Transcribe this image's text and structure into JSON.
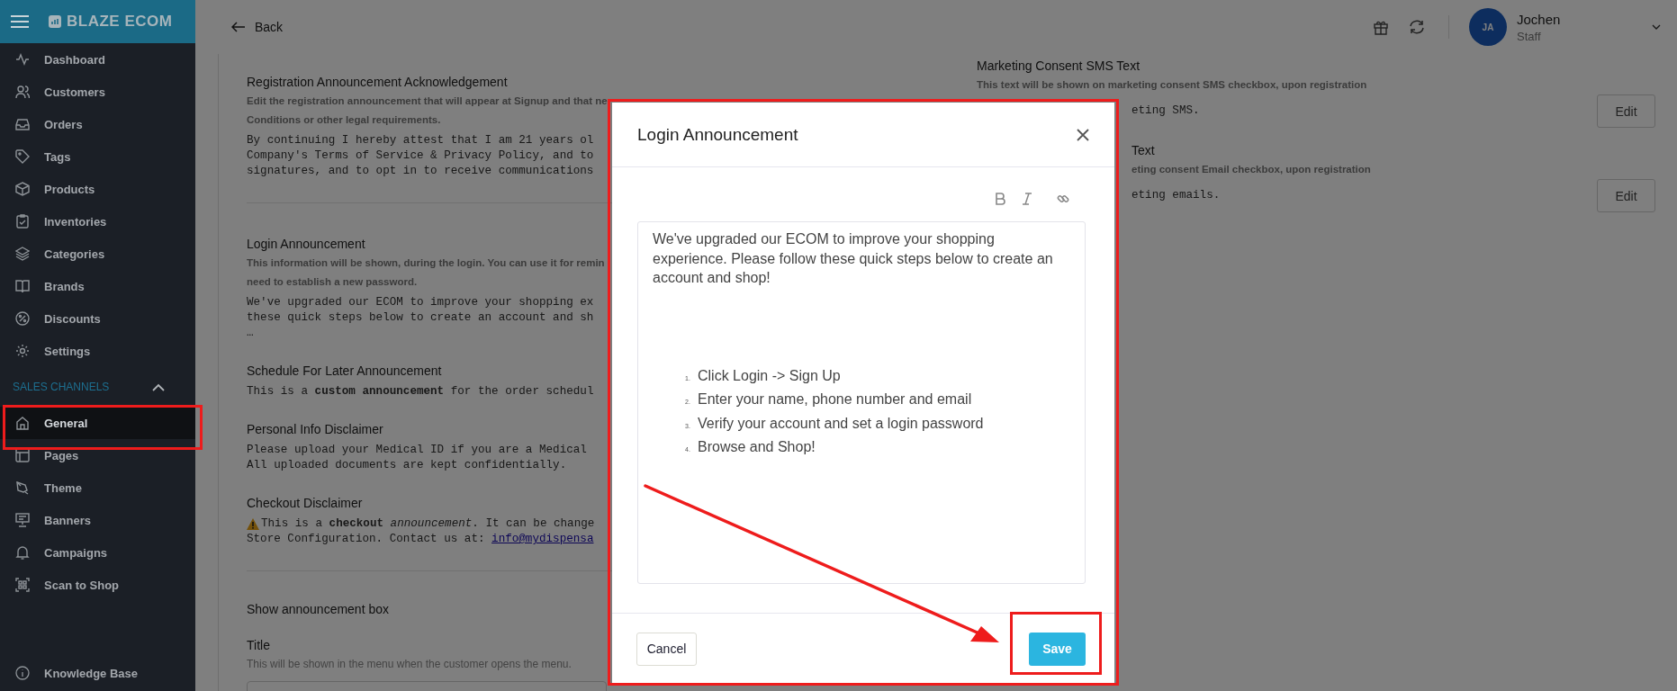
{
  "sidebar": {
    "brand": "BLAZE ECOM",
    "items": [
      {
        "label": "Dashboard",
        "selected": false
      },
      {
        "label": "Customers",
        "selected": false
      },
      {
        "label": "Orders",
        "selected": false
      },
      {
        "label": "Tags",
        "selected": false
      },
      {
        "label": "Products",
        "selected": false
      },
      {
        "label": "Inventories",
        "selected": false
      },
      {
        "label": "Categories",
        "selected": false
      },
      {
        "label": "Brands",
        "selected": false
      },
      {
        "label": "Discounts",
        "selected": false
      },
      {
        "label": "Settings",
        "selected": false
      }
    ],
    "section": {
      "label": "SALES CHANNELS",
      "expanded": true
    },
    "channel_items": [
      {
        "label": "General",
        "selected": true,
        "highlighted": true
      },
      {
        "label": "Pages",
        "selected": false,
        "highlighted": false
      },
      {
        "label": "Theme",
        "selected": false,
        "highlighted": false
      },
      {
        "label": "Banners",
        "selected": false,
        "highlighted": false
      },
      {
        "label": "Campaigns",
        "selected": false,
        "highlighted": false
      },
      {
        "label": "Scan to Shop",
        "selected": false,
        "highlighted": false
      }
    ],
    "footer_item": {
      "label": "Knowledge Base"
    }
  },
  "header": {
    "back": "Back",
    "user": {
      "initials": "JA",
      "name": "Jochen",
      "role": "Staff"
    }
  },
  "left_sections": [
    {
      "title": "Registration Announcement Acknowledgement",
      "description": [
        "Edit the registration announcement that will appear at Signup and that ne",
        "Conditions or other legal requirements."
      ],
      "body": [
        {
          "kind": "text",
          "text": "By continuing I hereby attest that I am 21 years ol"
        },
        {
          "kind": "text",
          "text": "Company's Terms of Service & Privacy Policy, and to"
        },
        {
          "kind": "text",
          "text": "signatures, and to opt in to receive communications"
        }
      ],
      "divider_after": true
    },
    {
      "title": "Login Announcement",
      "description": [
        "This information will be shown, during the login. You can use it for remin",
        "need to establish a new password."
      ],
      "body": [
        {
          "kind": "text",
          "text": "We've upgraded our ECOM to improve your shopping ex"
        },
        {
          "kind": "text",
          "text": "these quick steps below to create an account and sh"
        },
        {
          "kind": "text",
          "text": "…"
        }
      ],
      "divider_after": false
    },
    {
      "title": "Schedule For Later Announcement",
      "body": [
        {
          "kind": "text",
          "text": "This is a **custom announcement** for the order schedul"
        }
      ],
      "divider_after": false
    },
    {
      "title": "Personal Info Disclaimer",
      "body": [
        {
          "kind": "text",
          "text": "Please upload your Medical ID if you are a Medical"
        },
        {
          "kind": "text",
          "text": "All uploaded documents are kept confidentially."
        }
      ],
      "divider_after": false
    },
    {
      "title": "Checkout Disclaimer",
      "body": [
        {
          "kind": "warning",
          "text": "This is a **checkout** *announcement*. It can be change"
        },
        {
          "kind": "link",
          "text": "Store Configuration. Contact us at:",
          "link": "info@mydispensa"
        }
      ],
      "divider_after": true
    }
  ],
  "announcement_box": {
    "heading": "Show announcement box",
    "field_label": "Title",
    "field_hint": "This will be shown in the menu when the customer opens the menu."
  },
  "right_sections": [
    {
      "title": "Marketing Consent SMS Text",
      "description": "This text will be shown on marketing consent SMS checkbox, upon registration",
      "body": "eting SMS.",
      "button": "Edit"
    },
    {
      "title": "Text",
      "description": "eting consent Email checkbox, upon registration",
      "body": "eting emails.",
      "button": "Edit"
    }
  ],
  "modal": {
    "title": "Login Announcement",
    "highlighted": true,
    "editor": {
      "paragraph": "We've upgraded our ECOM to improve your shopping experience. Please follow these quick steps below to create an account and shop!",
      "steps": [
        {
          "number": "1.",
          "text": "Click Login -> Sign Up"
        },
        {
          "number": "2.",
          "text": "Enter your name, phone number and email"
        },
        {
          "number": "3.",
          "text": "Verify your account and set a login password"
        },
        {
          "number": "4.",
          "text": "Browse and Shop!"
        }
      ]
    },
    "cancel": "Cancel",
    "save": {
      "label": "Save",
      "highlighted": true
    }
  },
  "annotations": [
    {
      "kind": "arrow"
    }
  ]
}
